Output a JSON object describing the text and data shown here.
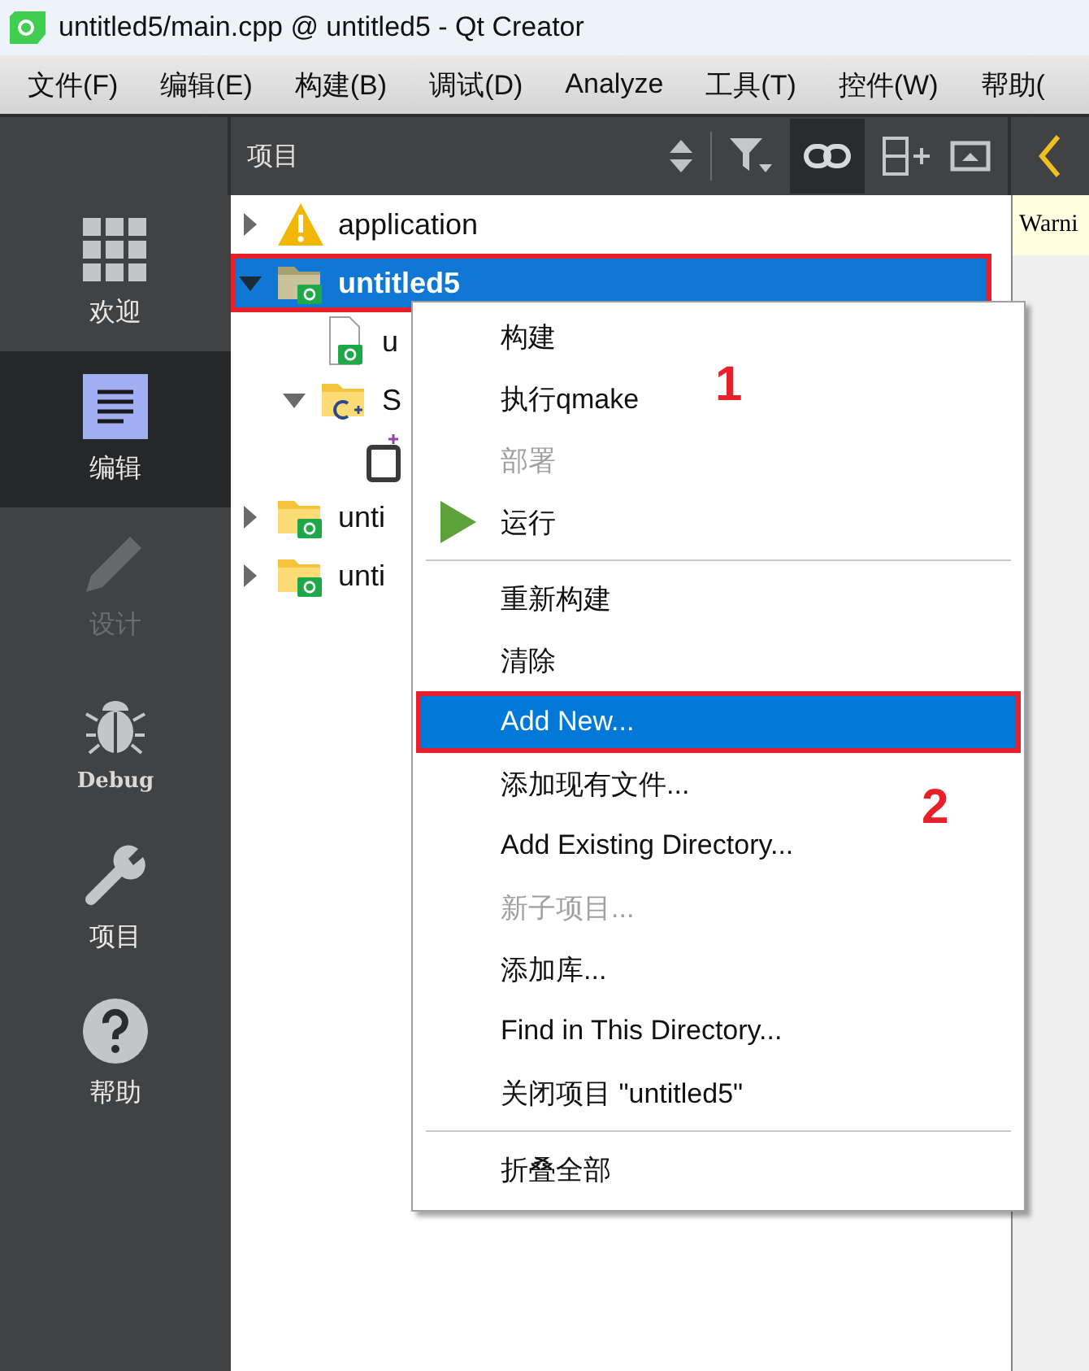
{
  "window": {
    "title": "untitled5/main.cpp @ untitled5 - Qt Creator"
  },
  "menu_bar": [
    "文件(F)",
    "编辑(E)",
    "构建(B)",
    "调试(D)",
    "Analyze",
    "工具(T)",
    "控件(W)",
    "帮助("
  ],
  "modes": [
    {
      "label": "欢迎",
      "kind": "welcome",
      "selected": false,
      "disabled": false
    },
    {
      "label": "编辑",
      "kind": "edit",
      "selected": true,
      "disabled": false
    },
    {
      "label": "设计",
      "kind": "design",
      "selected": false,
      "disabled": true
    },
    {
      "label": "Debug",
      "kind": "debug",
      "selected": false,
      "disabled": false
    },
    {
      "label": "项目",
      "kind": "projects",
      "selected": false,
      "disabled": false
    },
    {
      "label": "帮助",
      "kind": "help",
      "selected": false,
      "disabled": false
    }
  ],
  "toolbar": {
    "title": "项目",
    "link_toggled": true
  },
  "tree": [
    {
      "label": "application",
      "kind": "warning",
      "expanded": false,
      "selected": false,
      "highlighted": false
    },
    {
      "label": "untitled5",
      "kind": "project",
      "expanded": true,
      "selected": true,
      "highlighted": true,
      "children": [
        {
          "label": "u",
          "kind": "project_file",
          "selected": false,
          "highlighted": false
        },
        {
          "label": "S",
          "kind": "sources",
          "expanded": true,
          "selected": false,
          "highlighted": false,
          "children": [
            {
              "kind": "new_file",
              "selected": false,
              "highlighted": false
            }
          ]
        }
      ]
    },
    {
      "label": "unti",
      "kind": "project",
      "expanded": false,
      "selected": false,
      "highlighted": false
    },
    {
      "label": "unti",
      "kind": "project",
      "expanded": false,
      "selected": false,
      "highlighted": false
    }
  ],
  "editor": {
    "warning": "Warni"
  },
  "context_menu": [
    {
      "kind": "action",
      "label": "构建",
      "disabled": false,
      "selected": false,
      "highlighted": false
    },
    {
      "kind": "action",
      "label": "执行qmake",
      "disabled": false,
      "selected": false,
      "highlighted": false
    },
    {
      "kind": "action",
      "label": "部署",
      "disabled": true,
      "selected": false,
      "highlighted": false
    },
    {
      "kind": "run_action",
      "label": "运行",
      "disabled": false,
      "selected": false,
      "highlighted": false
    },
    {
      "kind": "separator"
    },
    {
      "kind": "action",
      "label": "重新构建",
      "disabled": false,
      "selected": false,
      "highlighted": false
    },
    {
      "kind": "action",
      "label": "清除",
      "disabled": false,
      "selected": false,
      "highlighted": false
    },
    {
      "kind": "action",
      "label": "Add New...",
      "disabled": false,
      "selected": true,
      "highlighted": true
    },
    {
      "kind": "action",
      "label": "添加现有文件...",
      "disabled": false,
      "selected": false,
      "highlighted": false
    },
    {
      "kind": "action",
      "label": "Add Existing Directory...",
      "disabled": false,
      "selected": false,
      "highlighted": false
    },
    {
      "kind": "action",
      "label": "新子项目...",
      "disabled": true,
      "selected": false,
      "highlighted": false
    },
    {
      "kind": "action",
      "label": "添加库...",
      "disabled": false,
      "selected": false,
      "highlighted": false
    },
    {
      "kind": "action",
      "label": "Find in This Directory...",
      "disabled": false,
      "selected": false,
      "highlighted": false
    },
    {
      "kind": "action",
      "label": "关闭项目 \"untitled5\"",
      "disabled": false,
      "selected": false,
      "highlighted": false
    },
    {
      "kind": "separator"
    },
    {
      "kind": "action",
      "label": "折叠全部",
      "disabled": false,
      "selected": false,
      "highlighted": false
    }
  ],
  "annotations": [
    "1",
    "2"
  ]
}
